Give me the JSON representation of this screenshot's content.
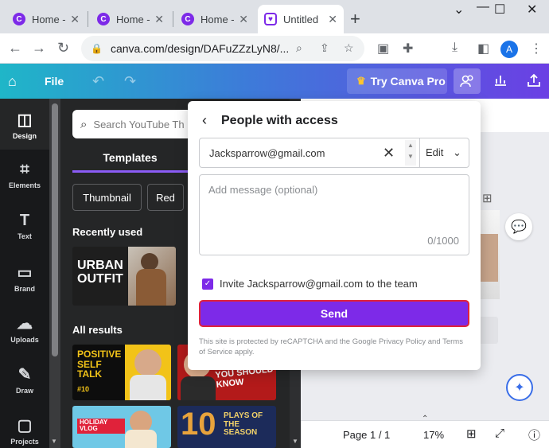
{
  "browser": {
    "tabs": [
      {
        "label": "Home -",
        "close": "✕"
      },
      {
        "label": "Home -",
        "close": "✕"
      },
      {
        "label": "Home -",
        "close": "✕"
      },
      {
        "label": "Untitled",
        "close": "✕"
      }
    ],
    "new_tab": "+",
    "url": "canva.com/design/DAFuZZzLyN8/...",
    "profile_initial": "A"
  },
  "canva_header": {
    "file_label": "File",
    "try_pro_label": "Try Canva Pro"
  },
  "rail": {
    "items": [
      {
        "label": "Design"
      },
      {
        "label": "Elements"
      },
      {
        "label": "Text"
      },
      {
        "label": "Brand"
      },
      {
        "label": "Uploads"
      },
      {
        "label": "Draw"
      },
      {
        "label": "Projects"
      }
    ]
  },
  "panel": {
    "search_placeholder": "Search YouTube Th",
    "templates_tab": "Templates",
    "chips": [
      "Thumbnail",
      "Red"
    ],
    "recently_used": "Recently used",
    "all_results": "All results",
    "thumbs": {
      "urban": "URBAN OUTFIT",
      "positive": "POSITIVE SELF TALK",
      "positive_num": "#10",
      "youshould": "YOU SHOULD KNOW",
      "vlog": "HOLIDAY VLOG",
      "ten": "10",
      "plays": "PLAYS OF THE SEASON"
    }
  },
  "popup": {
    "title": "People with access",
    "email_value": "Jacksparrow@gmail.com",
    "permission": "Edit",
    "message_placeholder": "Add message (optional)",
    "message_count": "0/1000",
    "invite_text": "Invite Jacksparrow@gmail.com to the team",
    "send_label": "Send",
    "recaptcha": "This site is protected by reCAPTCHA and the Google Privacy Policy and Terms of Service apply."
  },
  "bottom": {
    "page": "Page 1 / 1",
    "zoom": "17%"
  },
  "colors": {
    "accent": "#7d2ae8",
    "send_border": "#e0223a"
  }
}
